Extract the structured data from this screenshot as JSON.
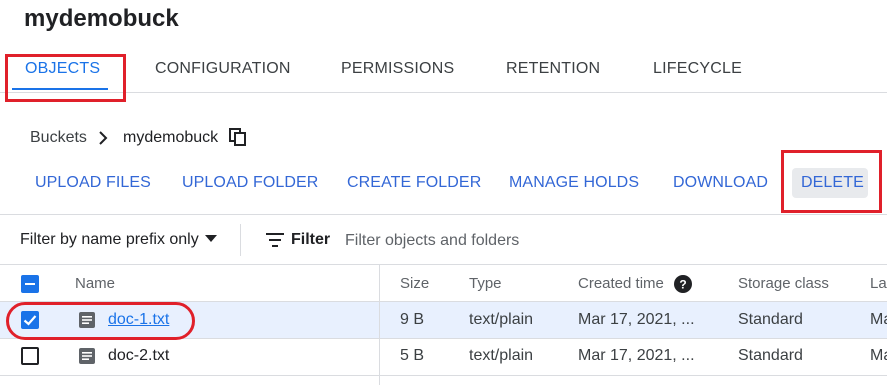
{
  "bucket": {
    "title": "mydemobuck"
  },
  "tabs": [
    {
      "label": "OBJECTS"
    },
    {
      "label": "CONFIGURATION"
    },
    {
      "label": "PERMISSIONS"
    },
    {
      "label": "RETENTION"
    },
    {
      "label": "LIFECYCLE"
    }
  ],
  "breadcrumb": {
    "root": "Buckets",
    "separator": ">",
    "current": "mydemobuck"
  },
  "actions": {
    "upload_files": "UPLOAD FILES",
    "upload_folder": "UPLOAD FOLDER",
    "create_folder": "CREATE FOLDER",
    "manage_holds": "MANAGE HOLDS",
    "download": "DOWNLOAD",
    "delete": "DELETE"
  },
  "filter": {
    "prefix_label": "Filter by name prefix only",
    "button_label": "Filter",
    "placeholder": "Filter objects and folders"
  },
  "table": {
    "columns": [
      "Name",
      "Size",
      "Type",
      "Created time",
      "Storage class",
      "La"
    ],
    "rows": [
      {
        "checked": true,
        "name": "doc-1.txt",
        "size": "9 B",
        "type": "text/plain",
        "created": "Mar 17, 2021, ...",
        "storage": "Standard",
        "last": "Ma"
      },
      {
        "checked": false,
        "name": "doc-2.txt",
        "size": "5 B",
        "type": "text/plain",
        "created": "Mar 17, 2021, ...",
        "storage": "Standard",
        "last": "Ma"
      }
    ]
  },
  "colors": {
    "accent": "#1a73e8",
    "action_text": "#3367d6",
    "selected_row": "#e8f0fe",
    "annotation": "#e0202a"
  },
  "icons": [
    "copy-icon",
    "chevron-right-icon",
    "caret-down-icon",
    "filter-icon",
    "help-icon",
    "file-icon",
    "checkbox-icon"
  ]
}
